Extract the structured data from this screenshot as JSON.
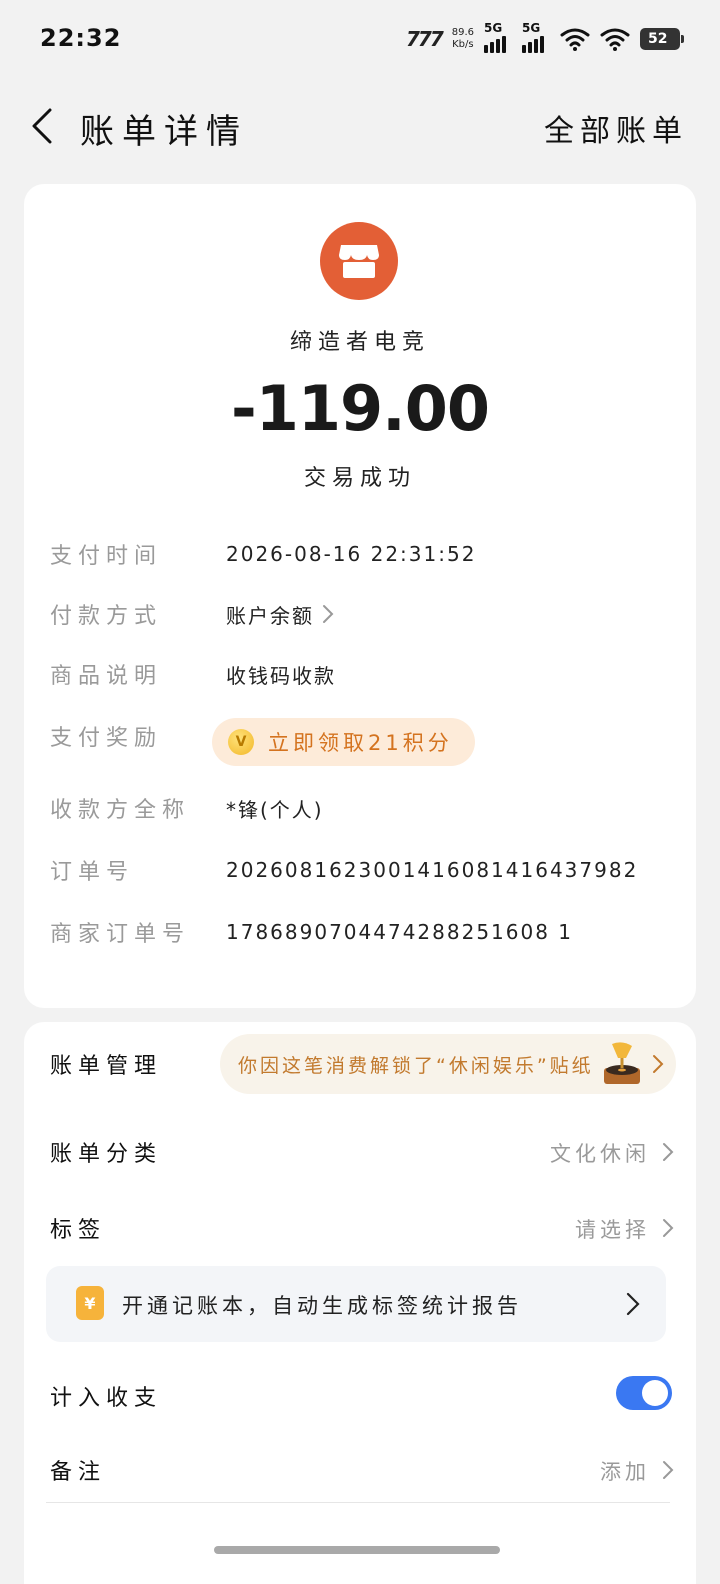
{
  "status_bar": {
    "time": "22:32",
    "brand": "777",
    "net_speed_value": "89.6",
    "net_speed_unit": "Kb/s",
    "signal1_label": "5G",
    "signal2_label": "5G",
    "battery": "52"
  },
  "header": {
    "title": "账单详情",
    "all_bills": "全部账单"
  },
  "summary": {
    "merchant_icon": "shop-icon",
    "merchant_name": "缔造者电竞",
    "amount": "-119.00",
    "status": "交易成功"
  },
  "details": {
    "pay_time_label": "支付时间",
    "pay_time_value": "2026-08-16 22:31:52",
    "pay_method_label": "付款方式",
    "pay_method_value": "账户余额",
    "goods_label": "商品说明",
    "goods_value": "收钱码收款",
    "reward_label": "支付奖励",
    "reward_coin": "V",
    "reward_value": "立即领取21积分",
    "payee_label": "收款方全称",
    "payee_value": "*锋(个人)",
    "order_no_label": "订单号",
    "order_no_value": "2026081623001416081416437982",
    "merchant_order_label": "商家订单号",
    "merchant_order_value": "1786890704474288251608 1"
  },
  "manage": {
    "bill_mgmt_label": "账单管理",
    "sticker_text": "你因这笔消费解锁了“休闲娱乐”贴纸",
    "category_label": "账单分类",
    "category_value": "文化休闲",
    "tag_label": "标签",
    "tag_value": "请选择",
    "promo_icon": "¥",
    "promo_text": "开通记账本，自动生成标签统计报告",
    "count_label": "计入收支",
    "count_enabled": true,
    "note_label": "备注",
    "note_value": "添加"
  },
  "colors": {
    "accent_blue": "#3a78f2",
    "merchant_orange": "#e35f36",
    "reward_text": "#d4731f"
  }
}
